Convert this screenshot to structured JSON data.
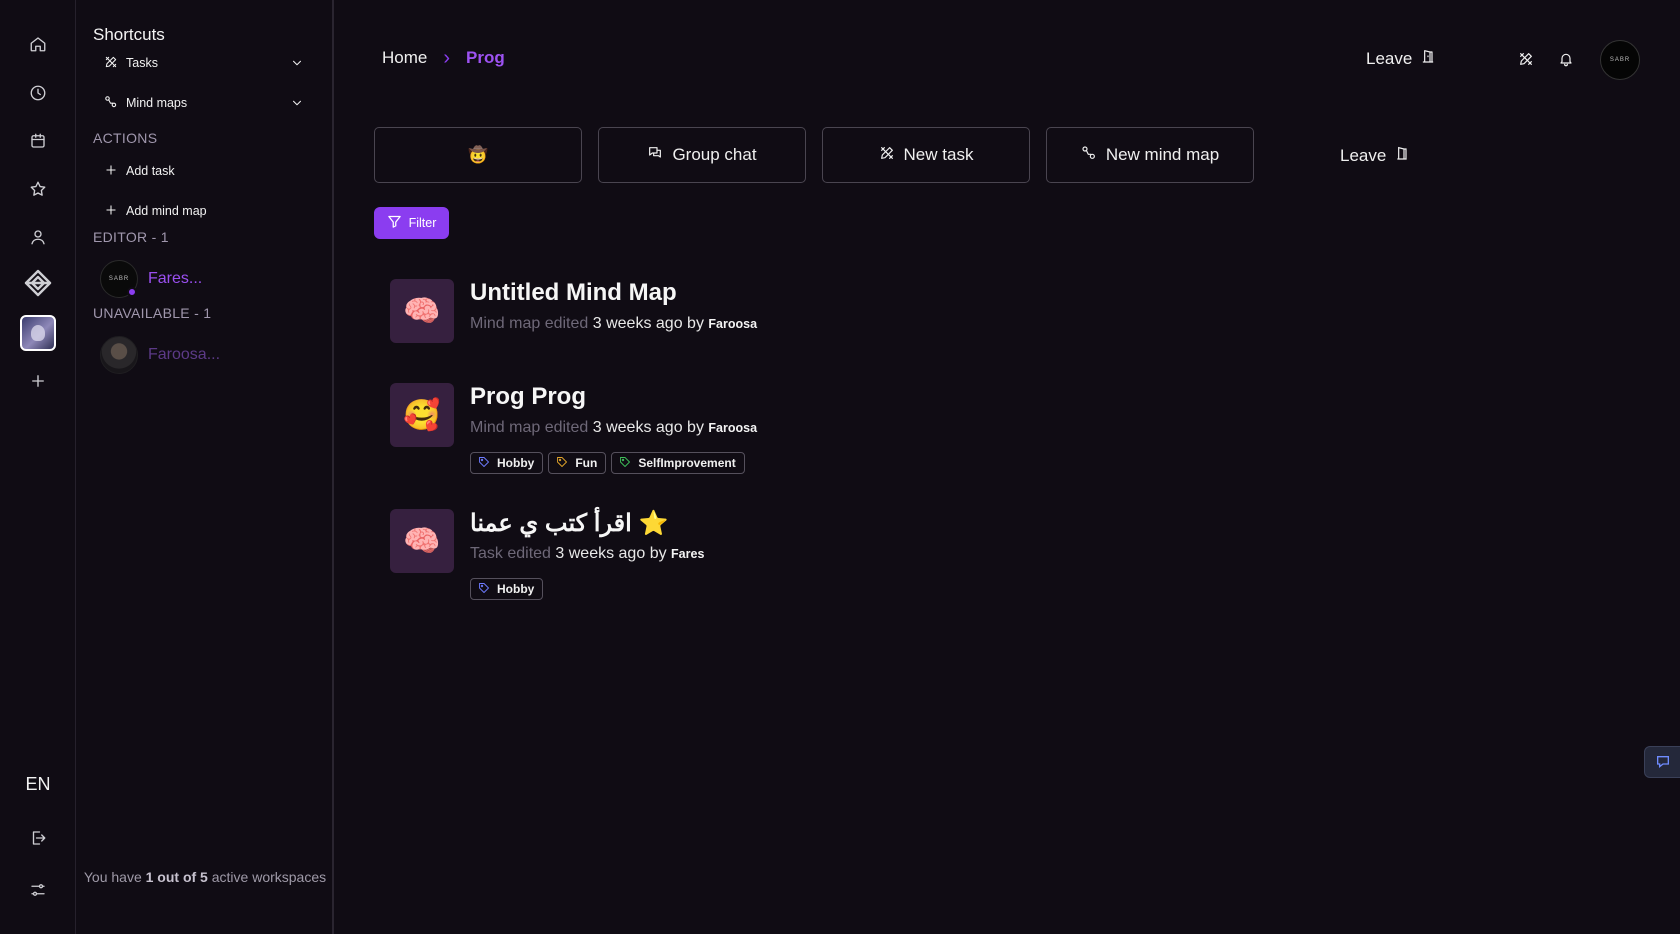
{
  "sidebar": {
    "shortcuts_title": "Shortcuts",
    "shortcuts": [
      {
        "label": "Tasks",
        "icon": "tasks-icon"
      },
      {
        "label": "Mind maps",
        "icon": "mindmap-icon"
      }
    ],
    "actions_title": "ACTIONS",
    "actions": [
      {
        "label": "Add task",
        "icon": "plus-icon"
      },
      {
        "label": "Add mind map",
        "icon": "plus-icon"
      }
    ],
    "editor_title": "EDITOR - 1",
    "editor_member": {
      "name": "Fares...",
      "avatar_text": "SABR"
    },
    "unavailable_title": "UNAVAILABLE - 1",
    "unavailable_member": {
      "name": "Faroosa..."
    },
    "footer": {
      "prefix": "You have ",
      "bold": "1 out of 5",
      "suffix": " active workspaces"
    }
  },
  "rail": {
    "language": "EN",
    "icons": [
      "home-icon",
      "clock-icon",
      "calendar-icon",
      "star-icon",
      "user-icon",
      "sabr-logo-icon",
      "workspace-avatar",
      "plus-icon",
      "logout-icon",
      "settings-sliders-icon"
    ]
  },
  "header": {
    "breadcrumb_home": "Home",
    "breadcrumb_current": "Prog",
    "leave_label": "Leave",
    "avatar_text": "SABR",
    "icons": [
      "tasks-icon",
      "bell-icon"
    ]
  },
  "actions_bar": {
    "emoji_button": "🤠",
    "group_chat": "Group chat",
    "new_task": "New task",
    "new_mind_map": "New mind map",
    "leave": "Leave",
    "filter": "Filter"
  },
  "items": [
    {
      "emoji": "🧠",
      "title": "Untitled Mind Map",
      "kind": "Mind map edited",
      "when": "3 weeks ago",
      "by": "by",
      "author": "Faroosa",
      "tags": []
    },
    {
      "emoji": "🥰",
      "title": "Prog Prog",
      "kind": "Mind map edited",
      "when": "3 weeks ago",
      "by": "by",
      "author": "Faroosa",
      "tags": [
        {
          "label": "Hobby",
          "color": "#6e7bff"
        },
        {
          "label": "Fun",
          "color": "#e0a32a"
        },
        {
          "label": "SelfImprovement",
          "color": "#3fbf5a"
        }
      ]
    },
    {
      "emoji": "🧠",
      "title": "اقرأ كتب ي عمنا",
      "title_star": "⭐",
      "kind": "Task edited",
      "when": "3 weeks ago",
      "by": "by",
      "author": "Fares",
      "tags": [
        {
          "label": "Hobby",
          "color": "#6e7bff"
        }
      ]
    }
  ],
  "colors": {
    "accent": "#8b3df0",
    "background": "#100c14",
    "thumb": "#36203f"
  }
}
